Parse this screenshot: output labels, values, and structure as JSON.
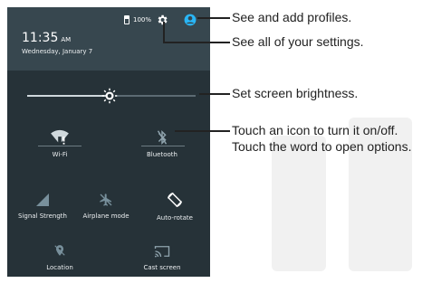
{
  "status": {
    "battery": "100%",
    "time": "11:35",
    "ampm": "AM",
    "date": "Wednesday, January 7"
  },
  "tiles": [
    {
      "label": "Wi-Fi",
      "icon": "wifi-icon"
    },
    {
      "label": "Bluetooth",
      "icon": "bluetooth-icon"
    },
    {
      "label": "Signal Strength",
      "icon": "signal-icon"
    },
    {
      "label": "Airplane mode",
      "icon": "airplane-icon"
    },
    {
      "label": "Auto-rotate",
      "icon": "auto-rotate-icon"
    },
    {
      "label": "Location",
      "icon": "location-icon"
    },
    {
      "label": "Cast screen",
      "icon": "cast-icon"
    }
  ],
  "annotations": {
    "profiles": "See and add profiles.",
    "settings": "See all of your settings.",
    "brightness": "Set screen brightness.",
    "toggle_line1": "Touch an icon to turn it on/off.",
    "toggle_line2": "Touch the word to open options."
  },
  "colors": {
    "panel": "#263238",
    "header": "#37474f",
    "accent": "#29b6f6"
  }
}
